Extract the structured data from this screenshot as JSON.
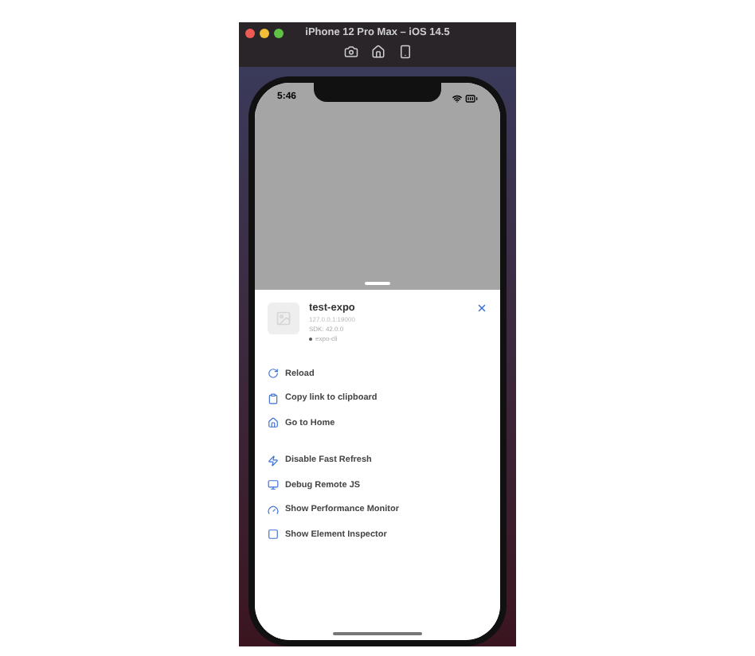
{
  "window": {
    "title": "iPhone 12 Pro Max – iOS 14.5"
  },
  "status_bar": {
    "time": "5:46"
  },
  "app": {
    "name": "test-expo",
    "host": "127.0.0.1:19000",
    "sdk": "SDK: 42.0.0",
    "runtime": "expo-cli"
  },
  "menu_groups": [
    {
      "items": [
        "Reload",
        "Copy link to clipboard",
        "Go to Home"
      ]
    },
    {
      "items": [
        "Disable Fast Refresh",
        "Debug Remote JS",
        "Show Performance Monitor",
        "Show Element Inspector"
      ]
    }
  ]
}
